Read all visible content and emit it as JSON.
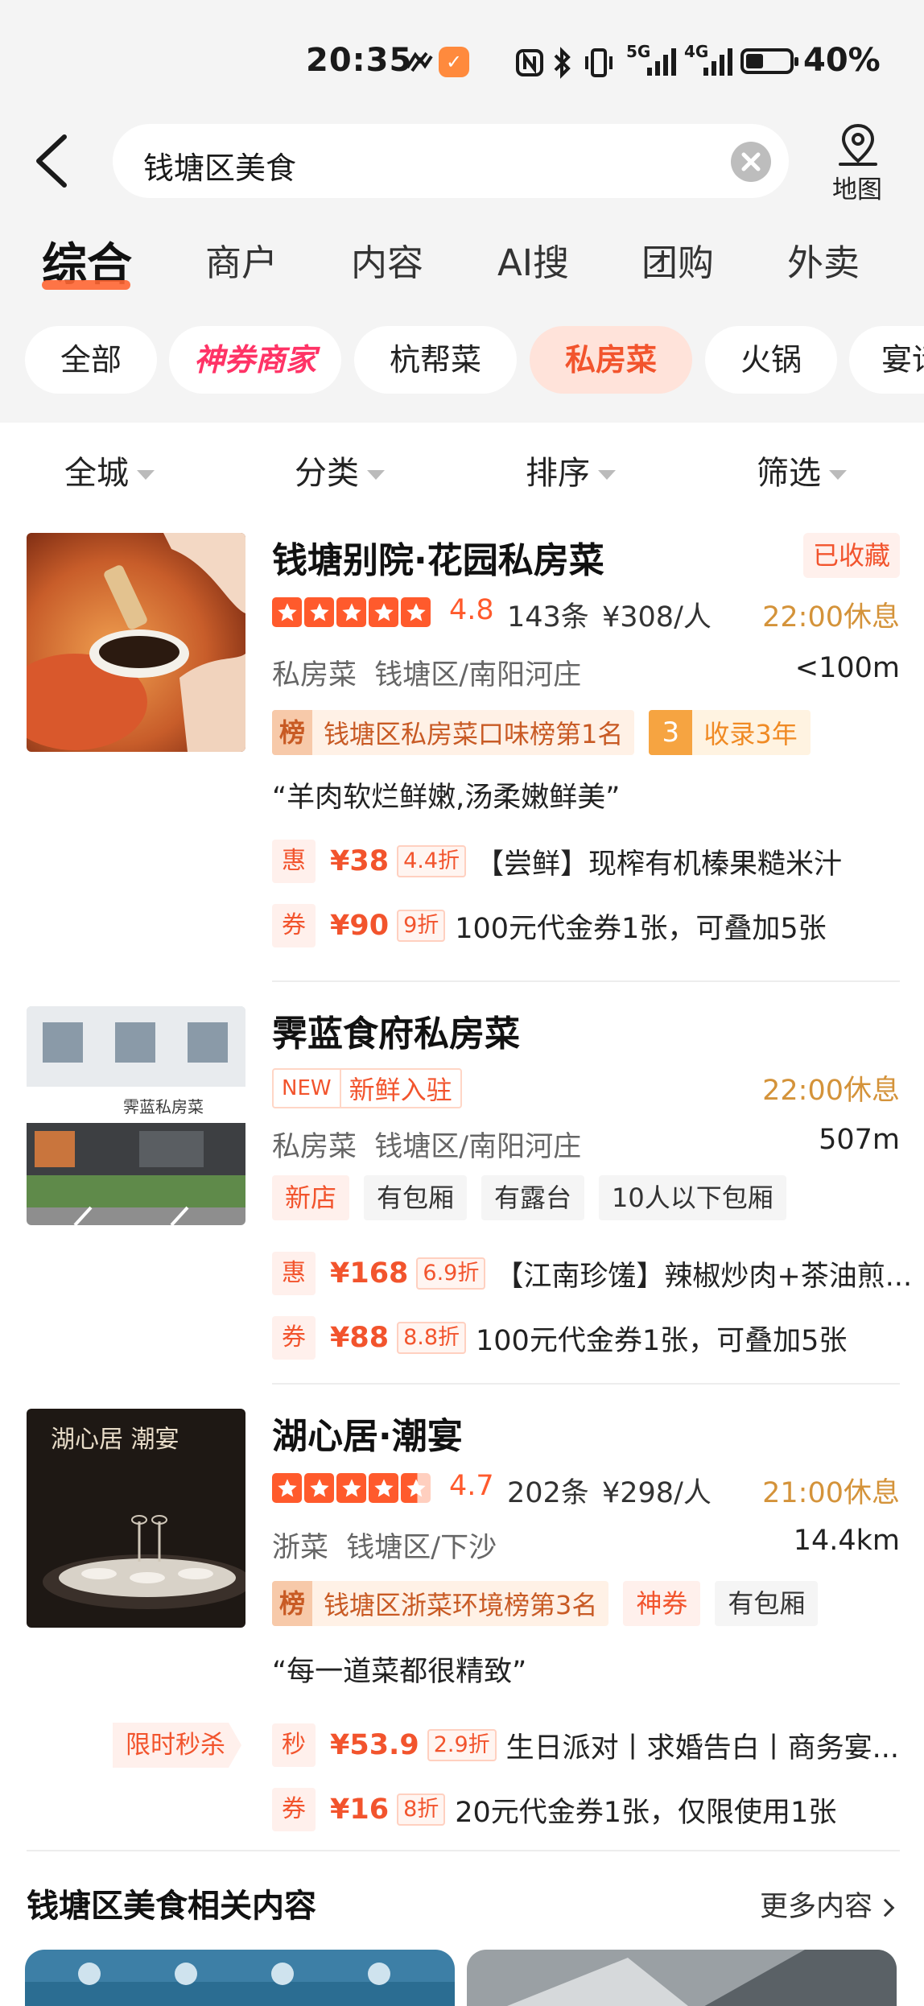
{
  "status_bar": {
    "time": "20:35",
    "signal_5g": "5G",
    "signal_4g": "4G",
    "battery_pct": "40%",
    "battery_level": 0.4
  },
  "search": {
    "query": "钱塘区美食",
    "map_label": "地图"
  },
  "tabs": [
    {
      "label": "综合",
      "active": true
    },
    {
      "label": "商户"
    },
    {
      "label": "内容"
    },
    {
      "label": "AI搜"
    },
    {
      "label": "团购"
    },
    {
      "label": "外卖"
    }
  ],
  "chips": [
    {
      "label": "全部"
    },
    {
      "label": "神券商家",
      "special": true
    },
    {
      "label": "杭帮菜"
    },
    {
      "label": "私房菜",
      "active": true
    },
    {
      "label": "火锅"
    },
    {
      "label": "宴请"
    }
  ],
  "filters": [
    {
      "label": "全城"
    },
    {
      "label": "分类"
    },
    {
      "label": "排序"
    },
    {
      "label": "筛选"
    }
  ],
  "colors": {
    "accent": "#f2542d",
    "star": "#ff5a2c",
    "hours": "#d4933a"
  },
  "listings": [
    {
      "title": "钱塘别院·花园私房菜",
      "fav_badge": "已收藏",
      "star_rating": 5,
      "rating": "4.8",
      "reviews": "143条",
      "price": "¥308/人",
      "hours": "22:00休息",
      "category": "私房菜",
      "area": "钱塘区/南阳河庄",
      "distance": "<100m",
      "rank_icon": "榜",
      "rank_text": "钱塘区私房菜口味榜第1名",
      "years_num": "3",
      "years_text": "收录3年",
      "quote": "“羊肉软烂鲜嫩,汤柔嫩鲜美”",
      "deals": [
        {
          "icon": "惠",
          "price": "¥38",
          "discount": "4.4折",
          "text": "【尝鲜】现榨有机榛果糙米汁"
        },
        {
          "icon": "券",
          "price": "¥90",
          "discount": "9折",
          "text": "100元代金券1张，可叠加5张"
        }
      ]
    },
    {
      "title": "霁蓝食府私房菜",
      "new_label": "NEW",
      "new_text": "新鲜入驻",
      "hours": "22:00休息",
      "category": "私房菜",
      "area": "钱塘区/南阳河庄",
      "distance": "507m",
      "sign_text": "霁蓝私房菜",
      "tags": [
        "新店",
        "有包厢",
        "有露台",
        "10人以下包厢"
      ],
      "deals": [
        {
          "icon": "惠",
          "price": "¥168",
          "discount": "6.9折",
          "text": "【江南珍馐】辣椒炒肉+茶油煎..."
        },
        {
          "icon": "券",
          "price": "¥88",
          "discount": "8.8折",
          "text": "100元代金券1张，可叠加5张"
        }
      ]
    },
    {
      "title": "湖心居·潮宴",
      "star_rating": 4.7,
      "rating": "4.7",
      "reviews": "202条",
      "price": "¥298/人",
      "hours": "21:00休息",
      "category": "浙菜",
      "area": "钱塘区/下沙",
      "distance": "14.4km",
      "thumb_title": "湖心居 潮宴",
      "rank_icon": "榜",
      "rank_text": "钱塘区浙菜环境榜第3名",
      "extra_tags": [
        "神券",
        "有包厢"
      ],
      "quote": "“每一道菜都很精致”",
      "flash_tag": "限时秒杀",
      "deals": [
        {
          "icon": "秒",
          "price": "¥53.9",
          "discount": "2.9折",
          "text": "生日派对丨求婚告白丨商务宴..."
        },
        {
          "icon": "券",
          "price": "¥16",
          "discount": "8折",
          "text": "20元代金券1张，仅限使用1张"
        }
      ]
    }
  ],
  "related": {
    "title": "钱塘区美食相关内容",
    "more": "更多内容"
  }
}
